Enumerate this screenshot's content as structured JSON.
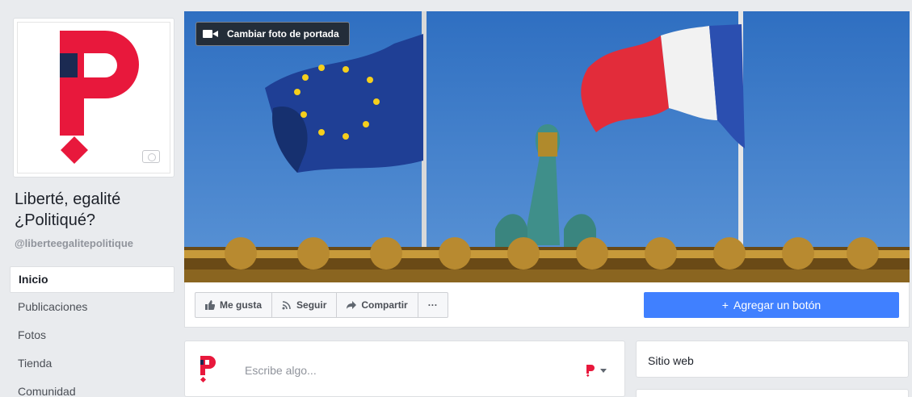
{
  "page": {
    "name": "Liberté, egalité ¿Politiqué?",
    "handle": "@liberteegalitepolitique"
  },
  "nav": {
    "items": [
      {
        "label": "Inicio"
      },
      {
        "label": "Publicaciones"
      },
      {
        "label": "Fotos"
      },
      {
        "label": "Tienda"
      },
      {
        "label": "Comunidad"
      }
    ]
  },
  "cover": {
    "change_label": "Cambiar foto de portada"
  },
  "actions": {
    "like_label": "Me gusta",
    "follow_label": "Seguir",
    "share_label": "Compartir",
    "more_label": "···",
    "add_button_label": "Agregar un botón"
  },
  "composer": {
    "placeholder": "Escribe algo..."
  },
  "sidebar_widget": {
    "title": "Sitio web"
  },
  "colors": {
    "brand_red": "#e8183c",
    "brand_navy": "#1b2a52",
    "fb_blue": "#4080ff"
  }
}
